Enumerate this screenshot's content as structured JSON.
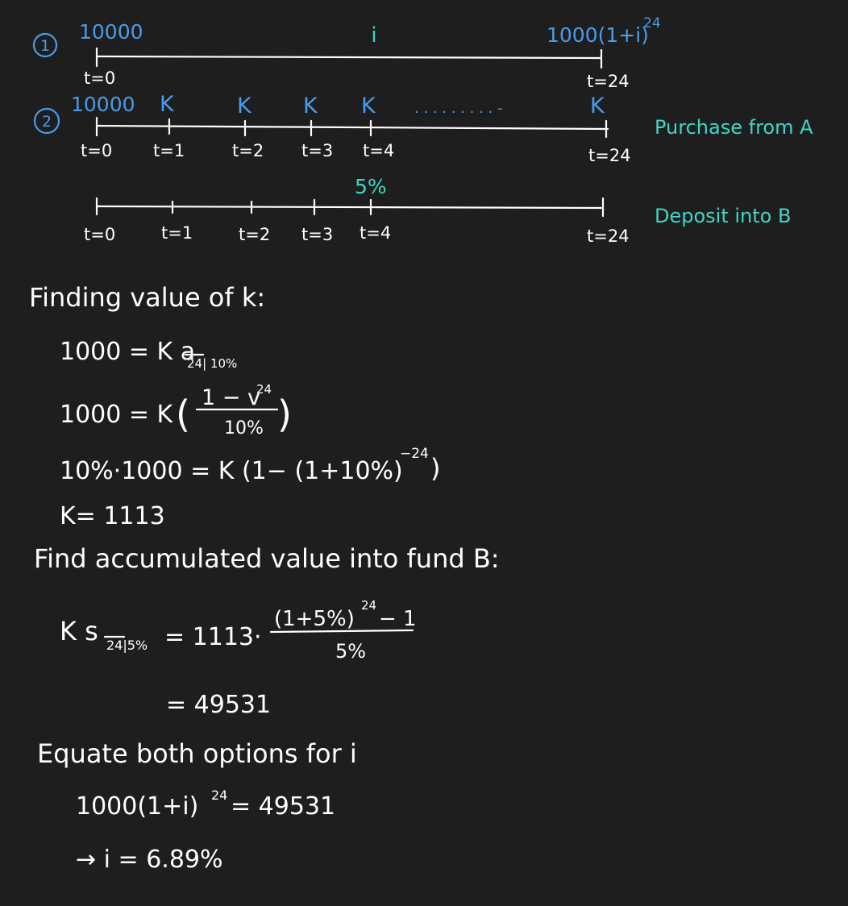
{
  "timeline1": {
    "marker": "1",
    "left_amount": "10000",
    "rate_label": "i",
    "right_amount": "1000(1+i)",
    "right_exponent": "24",
    "start_tick": "t=0",
    "end_tick": "t=24"
  },
  "timeline2": {
    "marker": "2",
    "left_amount": "10000",
    "payment_labels": [
      "K",
      "K",
      "K",
      "K",
      "K"
    ],
    "ellipsis": ". . . . . . . . . -",
    "ticks": [
      "t=0",
      "t=1",
      "t=2",
      "t=3",
      "t=4",
      "t=24"
    ],
    "caption": "Purchase from A"
  },
  "timeline3": {
    "rate_label": "5%",
    "ticks": [
      "t=0",
      "t=1",
      "t=2",
      "t=3",
      "t=4",
      "t=24"
    ],
    "caption": "Deposit into B"
  },
  "section1": {
    "heading": "Finding value of k:",
    "eq1_lhs": "1000 = K a",
    "eq1_sub": "24| 10%",
    "eq2_lhs": "1000 = K",
    "eq2_num": "1 − v",
    "eq2_num_exp": "24",
    "eq2_den": "10%",
    "eq3": "10%·1000 = K (1− (1+10%)",
    "eq3_exp": "−24",
    "eq3_close": ")",
    "result": "K= 1113"
  },
  "section2": {
    "heading": "Find accumulated value into fund B:",
    "lhs": "K s",
    "lhs_sub": "24|5%",
    "mid": "= 1113·",
    "frac_num": "(1+5%)",
    "frac_num_exp": "24",
    "frac_num_tail": "− 1",
    "frac_den": "5%",
    "result": "= 49531"
  },
  "section3": {
    "heading": "Equate both options for i",
    "eq_lhs": "1000(1+i)",
    "eq_exp": "24",
    "eq_rhs": "= 49531",
    "answer": "→ i = 6.89%"
  }
}
